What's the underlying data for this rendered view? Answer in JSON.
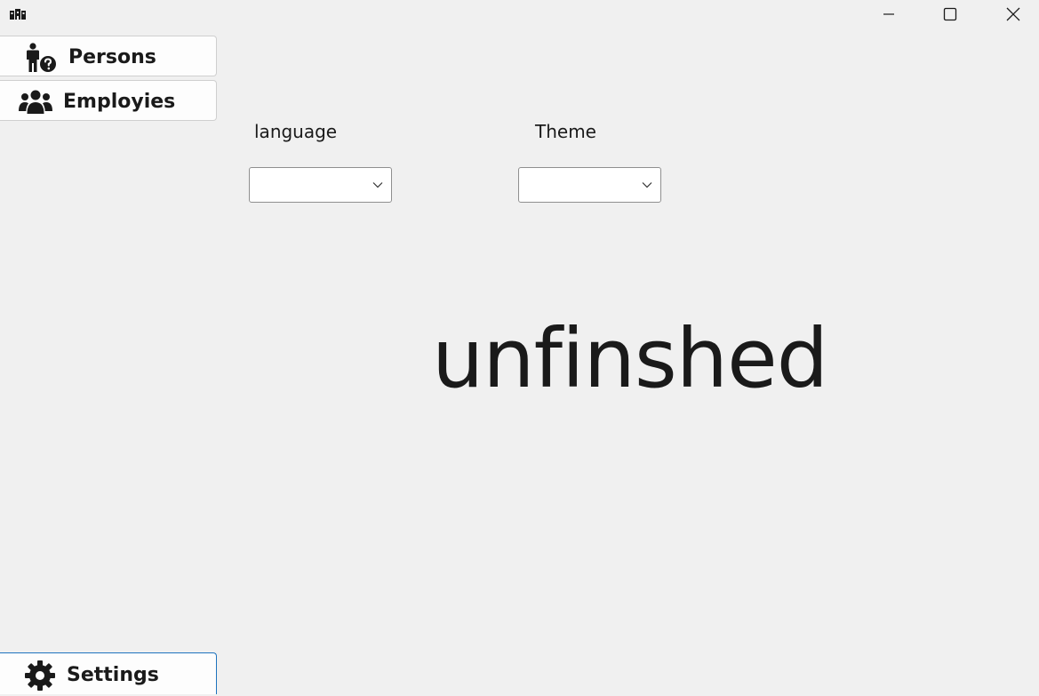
{
  "nav": {
    "persons_label": "Persons",
    "employies_label": "Employies",
    "settings_label": "Settings"
  },
  "settings": {
    "language_label": "language",
    "theme_label": "Theme",
    "language_value": "",
    "theme_value": ""
  },
  "main": {
    "status_text": "unfinshed"
  },
  "icons": {
    "app": "app-icon",
    "persons": "person-question-icon",
    "employies": "users-icon",
    "settings": "gear-icon"
  },
  "colors": {
    "background": "#f0f0f0",
    "button_bg": "#fdfdfd",
    "focus_border": "#1e73be",
    "text": "#1a1a1a"
  }
}
